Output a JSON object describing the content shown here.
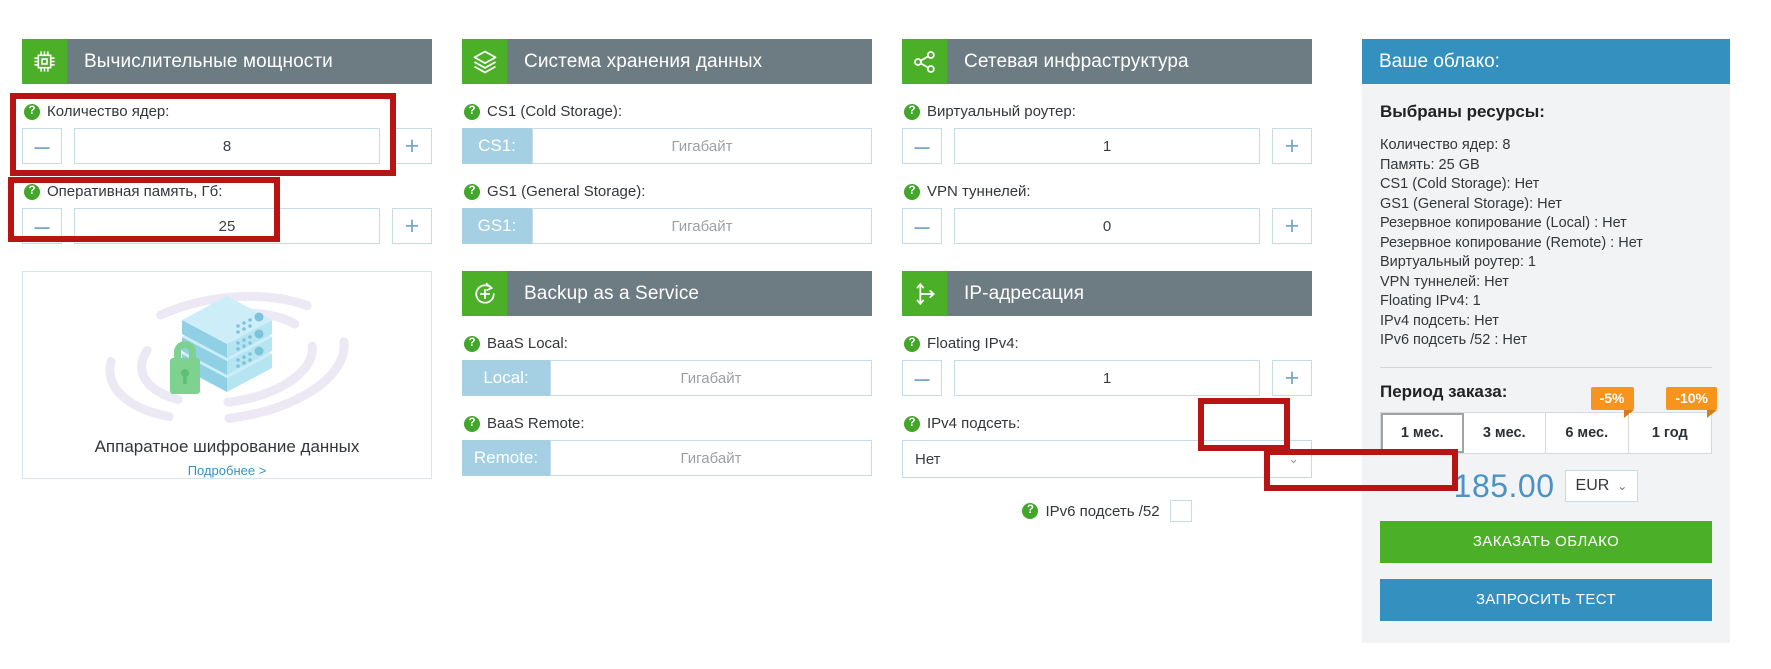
{
  "sections": {
    "compute": {
      "title": "Вычислительные мощности",
      "icon": "cpu-icon",
      "fields": {
        "cores": {
          "label": "Количество ядер:",
          "value": "8",
          "minus": "–",
          "plus": "+"
        },
        "ram": {
          "label": "Оперативная память, Гб:",
          "value": "25",
          "minus": "–",
          "plus": "+"
        }
      }
    },
    "storage": {
      "title": "Система хранения данных",
      "icon": "layers-icon",
      "fields": {
        "cs1": {
          "label": "CS1 (Cold Storage):",
          "prefix": "CS1:",
          "placeholder": "Гигабайт",
          "value": ""
        },
        "gs1": {
          "label": "GS1 (General Storage):",
          "prefix": "GS1:",
          "placeholder": "Гигабайт",
          "value": ""
        }
      }
    },
    "baas": {
      "title": "Backup as a Service",
      "icon": "backup-plus-icon",
      "fields": {
        "local": {
          "label": "BaaS Local:",
          "prefix": "Local:",
          "placeholder": "Гигабайт",
          "value": ""
        },
        "remote": {
          "label": "BaaS Remote:",
          "prefix": "Remote:",
          "placeholder": "Гигабайт",
          "value": ""
        }
      }
    },
    "network": {
      "title": "Сетевая инфраструктура",
      "icon": "network-share-icon",
      "fields": {
        "router": {
          "label": "Виртуальный роутер:",
          "value": "1",
          "minus": "–",
          "plus": "+"
        },
        "vpn": {
          "label": "VPN туннелей:",
          "value": "0",
          "minus": "–",
          "plus": "+"
        }
      }
    },
    "ip": {
      "title": "IP-адресация",
      "icon": "ip-routing-icon",
      "fields": {
        "floating": {
          "label": "Floating IPv4:",
          "value": "1",
          "minus": "–",
          "plus": "+"
        },
        "ipv4": {
          "label": "IPv4 подсеть:",
          "value": "Нет",
          "chevron": "⌄"
        },
        "ipv6": {
          "label": "IPv6 подсеть /52",
          "checked": false
        }
      }
    }
  },
  "promo": {
    "caption": "Аппаратное шифрование данных",
    "link": "Подробнее >",
    "icon": "server-lock-illustration"
  },
  "summary": {
    "header": "Ваше облако:",
    "subtitle": "Выбраны ресурсы:",
    "lines": [
      "Количество ядер: 8",
      "Память: 25 GB",
      "CS1 (Cold Storage): Нет",
      "GS1 (General Storage): Нет",
      "Резервное копирование (Local) : Нет",
      "Резервное копирование (Remote) : Нет",
      "Виртуальный роутер: 1",
      "VPN туннелей: Нет",
      "Floating IPv4: 1",
      "IPv4 подсеть: Нет",
      "IPv6 подсеть /52 : Нет"
    ],
    "period_title": "Период заказа:",
    "periods": [
      {
        "label": "1 мес.",
        "badge": "",
        "selected": true
      },
      {
        "label": "3 мес.",
        "badge": "",
        "selected": false
      },
      {
        "label": "6 мес.",
        "badge": "-5%",
        "selected": false
      },
      {
        "label": "1 год",
        "badge": "-10%",
        "selected": false
      }
    ],
    "price": "185.00",
    "currency": "EUR",
    "currency_chevron": "⌄",
    "order_button": "ЗАКАЗАТЬ ОБЛАКО",
    "test_button": "ЗАПРОСИТЬ ТЕСТ"
  },
  "colors": {
    "green": "#4caf28",
    "slate": "#6d7b83",
    "blue": "#3490bf",
    "lightblue": "#a5cfe3",
    "orange": "#f7941e",
    "annotation_red": "#b81414"
  }
}
